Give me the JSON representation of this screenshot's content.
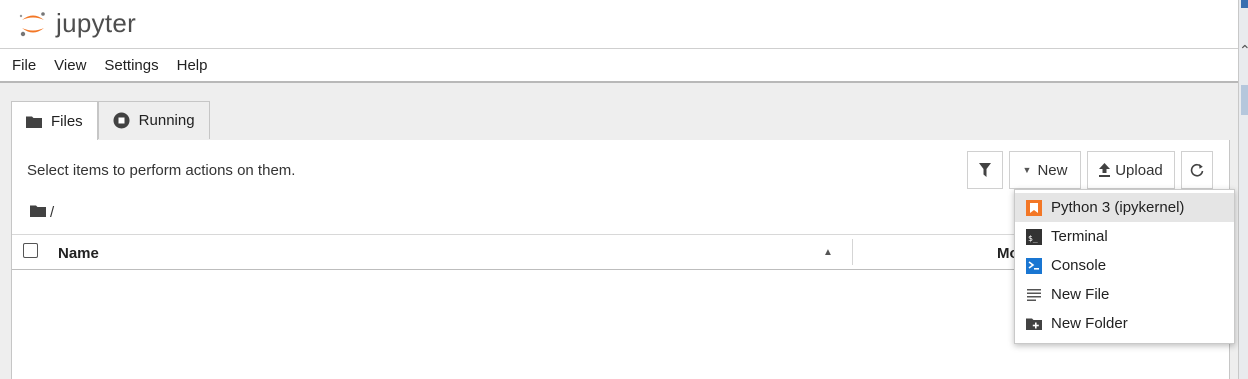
{
  "app": {
    "logo_text": "jupyter"
  },
  "menu": [
    "File",
    "View",
    "Settings",
    "Help"
  ],
  "tabs": [
    {
      "label": "Files",
      "icon": "folder-icon",
      "active": true
    },
    {
      "label": "Running",
      "icon": "stop-circle-icon",
      "active": false
    }
  ],
  "file_browser": {
    "hint": "Select items to perform actions on them.",
    "toolbar": {
      "filter_icon": "filter-icon",
      "new_label": "New",
      "upload_label": "Upload",
      "refresh_icon": "refresh-icon"
    },
    "breadcrumb": "/",
    "columns": {
      "name": "Name",
      "modified": "Mo"
    }
  },
  "new_menu": {
    "items": [
      {
        "label": "Python 3 (ipykernel)",
        "icon": "python-notebook-icon",
        "highlighted": true
      },
      {
        "label": "Terminal",
        "icon": "terminal-icon"
      },
      {
        "label": "Console",
        "icon": "console-icon"
      },
      {
        "label": "New File",
        "icon": "text-file-icon"
      },
      {
        "label": "New Folder",
        "icon": "new-folder-icon"
      }
    ]
  },
  "colors": {
    "accent_orange": "#f37726",
    "console_blue": "#1976d2",
    "menu_highlight": "#e5e5e5"
  }
}
